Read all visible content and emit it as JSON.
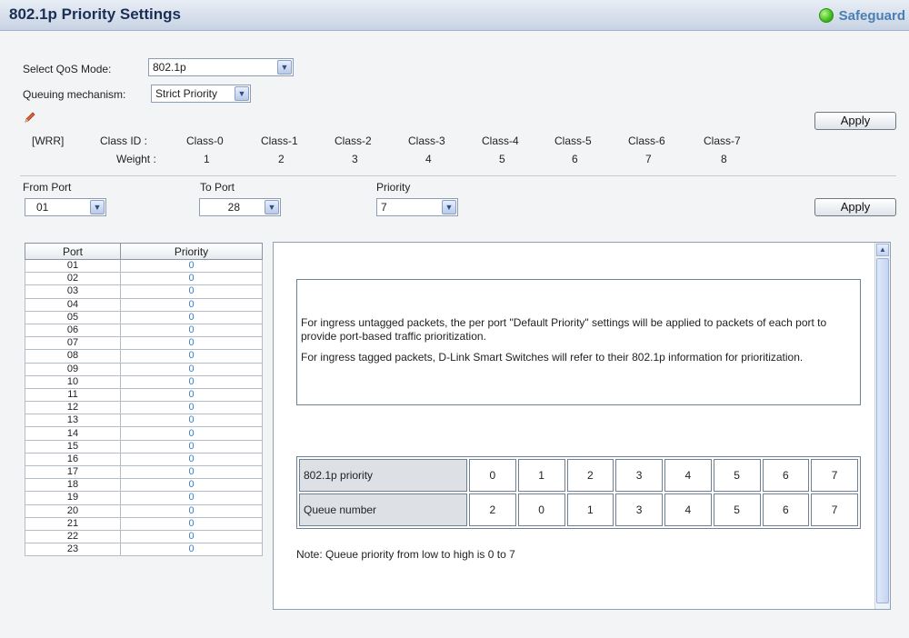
{
  "header": {
    "title": "802.1p Priority Settings",
    "safeguard": "Safeguard"
  },
  "qos": {
    "mode_label": "Select QoS Mode:",
    "mode_value": "802.1p",
    "queuing_label": "Queuing mechanism:",
    "queuing_value": "Strict Priority"
  },
  "wrr": {
    "tag": "[WRR]",
    "class_id_label": "Class ID :",
    "weight_label": "Weight :",
    "classes": [
      "Class-0",
      "Class-1",
      "Class-2",
      "Class-3",
      "Class-4",
      "Class-5",
      "Class-6",
      "Class-7"
    ],
    "weights": [
      "1",
      "2",
      "3",
      "4",
      "5",
      "6",
      "7",
      "8"
    ]
  },
  "apply_label": "Apply",
  "port_form": {
    "from_label": "From Port",
    "from_value": "01",
    "to_label": "To Port",
    "to_value": "28",
    "priority_label": "Priority",
    "priority_value": "7"
  },
  "port_table": {
    "headers": [
      "Port",
      "Priority"
    ],
    "rows": [
      [
        "01",
        "0"
      ],
      [
        "02",
        "0"
      ],
      [
        "03",
        "0"
      ],
      [
        "04",
        "0"
      ],
      [
        "05",
        "0"
      ],
      [
        "06",
        "0"
      ],
      [
        "07",
        "0"
      ],
      [
        "08",
        "0"
      ],
      [
        "09",
        "0"
      ],
      [
        "10",
        "0"
      ],
      [
        "11",
        "0"
      ],
      [
        "12",
        "0"
      ],
      [
        "13",
        "0"
      ],
      [
        "14",
        "0"
      ],
      [
        "15",
        "0"
      ],
      [
        "16",
        "0"
      ],
      [
        "17",
        "0"
      ],
      [
        "18",
        "0"
      ],
      [
        "19",
        "0"
      ],
      [
        "20",
        "0"
      ],
      [
        "21",
        "0"
      ],
      [
        "22",
        "0"
      ],
      [
        "23",
        "0"
      ]
    ]
  },
  "info": {
    "p1": "For ingress untagged packets, the per port \"Default Priority\" settings will be applied to packets of each port to provide port-based traffic prioritization.",
    "p2": "For ingress tagged packets, D-Link Smart Switches will refer to their 802.1p information for prioritization.",
    "table_row1_label": "802.1p priority",
    "table_row1": [
      "0",
      "1",
      "2",
      "3",
      "4",
      "5",
      "6",
      "7"
    ],
    "table_row2_label": "Queue number",
    "table_row2": [
      "2",
      "0",
      "1",
      "3",
      "4",
      "5",
      "6",
      "7"
    ],
    "note": "Note: Queue priority from low to high is 0 to 7"
  }
}
